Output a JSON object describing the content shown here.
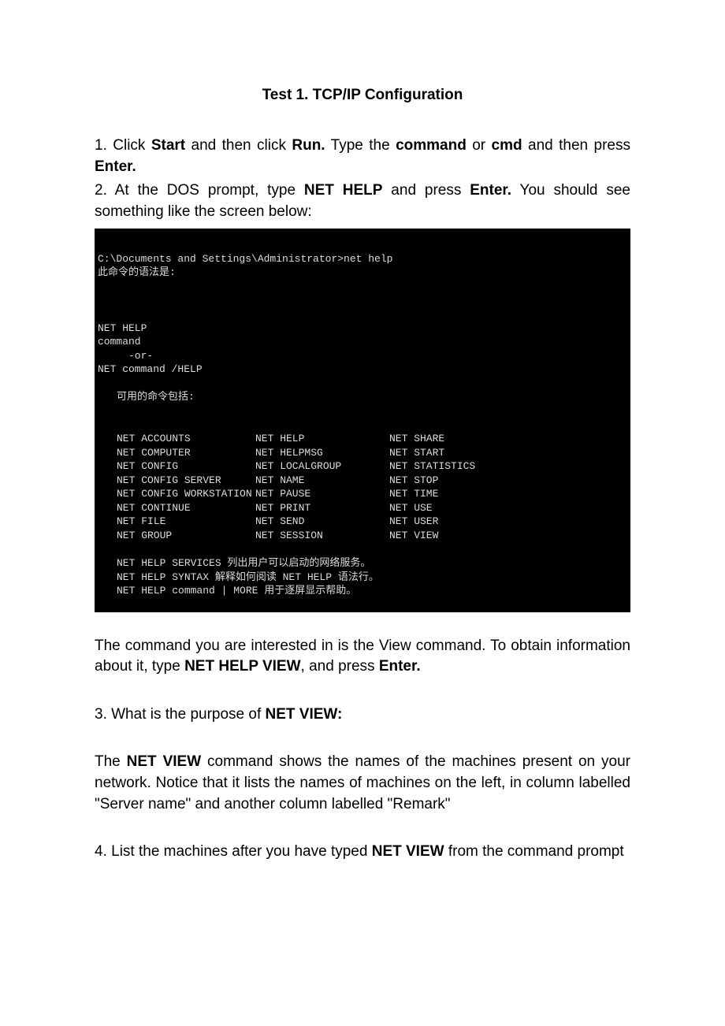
{
  "title": "Test 1.   TCP/IP Configuration",
  "p1_a": "1. Click ",
  "p1_b": "Start",
  "p1_c": " and then click ",
  "p1_d": "Run.",
  "p1_e": " Type the ",
  "p1_f": "command",
  "p1_g": " or ",
  "p1_h": "cmd",
  "p1_i": " and then press ",
  "p1_j": "Enter.",
  "p2_a": "2. At the DOS prompt, type ",
  "p2_b": "NET HELP",
  "p2_c": " and press ",
  "p2_d": "Enter.",
  "p2_e": " You should see something like the screen below:",
  "term": {
    "l1": "C:\\Documents and Settings\\Administrator>net help",
    "l2": "此命令的语法是:",
    "l3": "NET HELP",
    "l4": "command",
    "l5": "     -or-",
    "l6": "NET command /HELP",
    "l7": "可用的命令包括:",
    "cols": [
      [
        "NET ACCOUNTS",
        "NET HELP",
        "NET SHARE"
      ],
      [
        "NET COMPUTER",
        "NET HELPMSG",
        "NET START"
      ],
      [
        "NET CONFIG",
        "NET LOCALGROUP",
        "NET STATISTICS"
      ],
      [
        "NET CONFIG SERVER",
        "NET NAME",
        "NET STOP"
      ],
      [
        "NET CONFIG WORKSTATION",
        "NET PAUSE",
        "NET TIME"
      ],
      [
        "NET CONTINUE",
        "NET PRINT",
        "NET USE"
      ],
      [
        "NET FILE",
        "NET SEND",
        "NET USER"
      ],
      [
        "NET GROUP",
        "NET SESSION",
        "NET VIEW"
      ]
    ],
    "f1": "NET HELP SERVICES 列出用户可以启动的网络服务。",
    "f2": "NET HELP SYNTAX 解释如何阅读 NET HELP 语法行。",
    "f3": "NET HELP command | MORE 用于逐屏显示帮助。"
  },
  "p3_a": "The command you are interested in is the View command. To obtain information about it, type ",
  "p3_b": "NET HELP VIEW",
  "p3_c": ", and press ",
  "p3_d": "Enter.",
  "p4_a": "3. What is the purpose of ",
  "p4_b": "NET   VIEW:",
  "p5_a": "The ",
  "p5_b": "NET VIEW",
  "p5_c": " command shows the names of the machines present on your network. Notice that it lists the names of machines on the left, in column labelled \"Server name\" and another column labelled \"Remark\"",
  "p6_a": "4. List the machines after you have typed ",
  "p6_b": "NET VIEW",
  "p6_c": " from the command prompt"
}
